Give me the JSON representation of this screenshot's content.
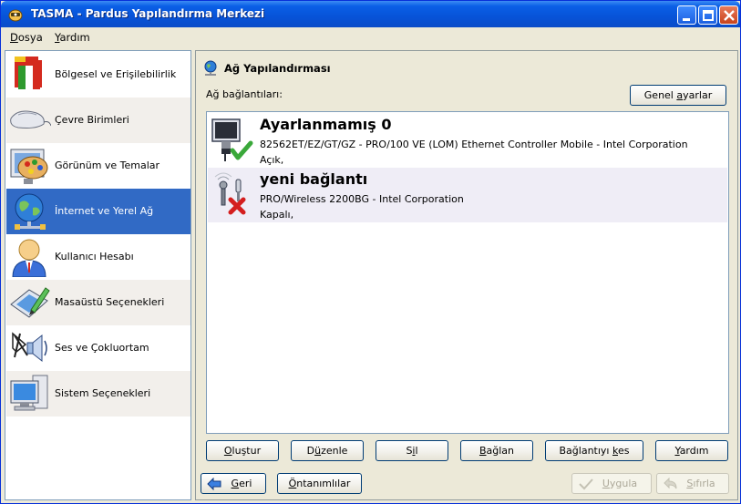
{
  "window": {
    "title": "TASMA - Pardus Yapılandırma Merkezi"
  },
  "menubar": {
    "items": [
      {
        "label": "Dosya",
        "key": "D",
        "rest": "osya"
      },
      {
        "label": "Yardım",
        "key": "Y",
        "rest": "ardım"
      }
    ]
  },
  "sidebar": {
    "items": [
      {
        "label": "Bölgesel ve Erişilebilirlik",
        "icon": "flag-icon"
      },
      {
        "label": "Çevre Birimleri",
        "icon": "mouse-icon"
      },
      {
        "label": "Görünüm ve Temalar",
        "icon": "palette-icon"
      },
      {
        "label": "İnternet ve Yerel Ağ",
        "icon": "globe-network-icon",
        "selected": true
      },
      {
        "label": "Kullanıcı Hesabı",
        "icon": "user-icon"
      },
      {
        "label": "Masaüstü Seçenekleri",
        "icon": "desktop-pen-icon"
      },
      {
        "label": "Ses ve Çokluortam",
        "icon": "speaker-icon"
      },
      {
        "label": "Sistem Seçenekleri",
        "icon": "computer-icon"
      }
    ]
  },
  "panel": {
    "title": "Ağ Yapılandırması",
    "connections_label": "Ağ bağlantıları:",
    "general_settings": {
      "pre": "Genel ",
      "key": "a",
      "post": "yarlar"
    }
  },
  "connections": [
    {
      "name": "Ayarlanmamış 0",
      "device": "82562ET/EZ/GT/GZ - PRO/100 VE (LOM) Ethernet Controller Mobile - Intel Corporation",
      "state": "Açık,",
      "icon": "wired-connected-icon"
    },
    {
      "name": "yeni bağlantı",
      "device": "PRO/Wireless 2200BG - Intel Corporation",
      "state": "Kapalı,",
      "icon": "wireless-disconnected-icon"
    }
  ],
  "actions": {
    "create": {
      "pre": "",
      "key": "O",
      "post": "luştur"
    },
    "edit": {
      "pre": "D",
      "key": "ü",
      "post": "zenle"
    },
    "delete": {
      "pre": "S",
      "key": "i",
      "post": "l"
    },
    "connect": {
      "pre": "",
      "key": "B",
      "post": "ağlan"
    },
    "disconnect": {
      "pre": "Bağlantıyı ",
      "key": "k",
      "post": "es"
    },
    "help": {
      "pre": "",
      "key": "Y",
      "post": "ardım"
    }
  },
  "footer": {
    "back": {
      "pre": "",
      "key": "G",
      "post": "eri"
    },
    "defaults": {
      "pre": "",
      "key": "Ö",
      "post": "ntanımlılar"
    },
    "apply": {
      "pre": "",
      "key": "U",
      "post": "ygula"
    },
    "reset": {
      "pre": "",
      "key": "S",
      "post": "ıfırla"
    }
  },
  "colors": {
    "titlebar": "#0753d8",
    "selection": "#316ac5",
    "face": "#ece9d8"
  }
}
